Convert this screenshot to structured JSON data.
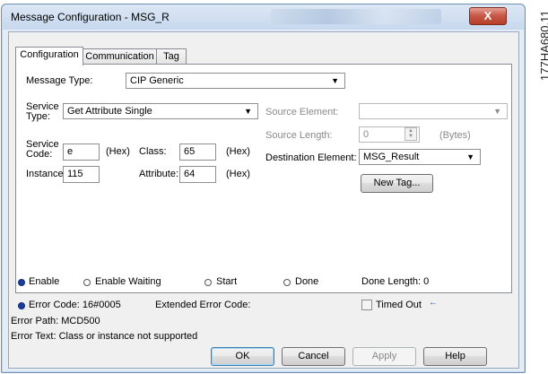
{
  "window": {
    "title": "Message Configuration - MSG_R",
    "close_glyph": "X"
  },
  "tabs": [
    {
      "label": "Configuration"
    },
    {
      "label": "Communication"
    },
    {
      "label": "Tag"
    }
  ],
  "config": {
    "message_type_label": "Message Type:",
    "message_type_value": "CIP Generic",
    "service_type_label": "Service\nType:",
    "service_type_value": "Get Attribute Single",
    "service_code_label": "Service\nCode:",
    "service_code_value": "e",
    "hex1": "(Hex)",
    "class_label": "Class:",
    "class_value": "65",
    "hex2": "(Hex)",
    "instance_label": "Instance:",
    "instance_value": "115",
    "attribute_label": "Attribute:",
    "attribute_value": "64",
    "hex3": "(Hex)",
    "source_element_label": "Source Element:",
    "source_element_value": "",
    "source_length_label": "Source Length:",
    "source_length_value": "0",
    "bytes_label": "(Bytes)",
    "destination_element_label": "Destination Element:",
    "destination_element_value": "MSG_Result",
    "new_tag_button": "New Tag..."
  },
  "status": {
    "enable": "Enable",
    "enable_waiting": "Enable Waiting",
    "start": "Start",
    "done": "Done",
    "done_length": "Done Length:  0",
    "error_code": "Error Code:  16#0005",
    "extended_error_code": "Extended Error Code:",
    "timed_out": "Timed Out",
    "timed_out_marker": "←",
    "error_path": "Error Path:  MCD500",
    "error_text": "Error Text:  Class or instance not supported"
  },
  "buttons": {
    "ok": "OK",
    "cancel": "Cancel",
    "apply": "Apply",
    "help": "Help"
  },
  "figure_id": "177HA680.11",
  "colors": {
    "radio_selected": "#1c3d9a",
    "timed_out_marker": "#2a52be"
  }
}
